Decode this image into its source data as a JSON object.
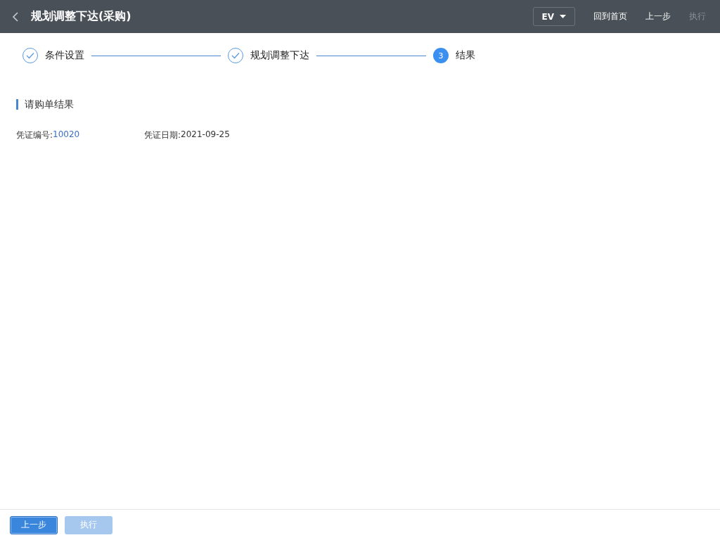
{
  "header": {
    "title": "规划调整下达(采购)",
    "dropdown": "EV",
    "buttons": [
      {
        "label": "回到首页",
        "disabled": false
      },
      {
        "label": "上一步",
        "disabled": false
      },
      {
        "label": "执行",
        "disabled": true
      }
    ]
  },
  "steps": [
    {
      "label": "条件设置",
      "completed": true
    },
    {
      "label": "规划调整下达",
      "completed": true
    },
    {
      "label": "结果",
      "completed": false,
      "number": "3"
    }
  ],
  "section": {
    "title": "请购单结果"
  },
  "fields": [
    {
      "label": "凭证编号:",
      "value": "10020",
      "kind": "link"
    },
    {
      "label": "凭证日期:",
      "value": "2021-09-25",
      "kind": "plain"
    }
  ],
  "footer": {
    "buttons": [
      {
        "label": "上一步",
        "disabled": false
      },
      {
        "label": "执行",
        "disabled": true
      }
    ]
  }
}
